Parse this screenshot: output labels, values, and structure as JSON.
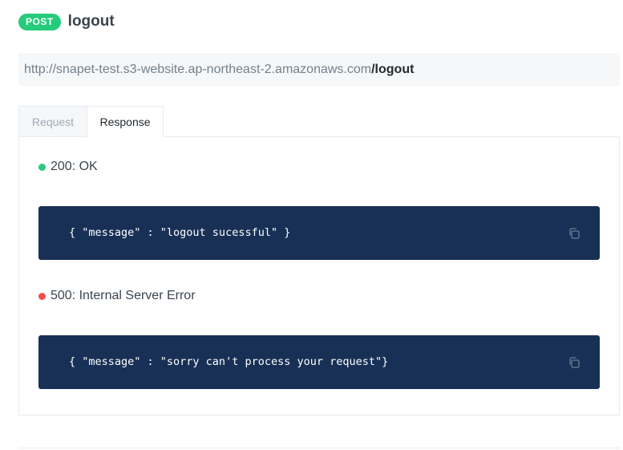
{
  "endpoint": {
    "method": "POST",
    "title": "logout",
    "url_base": "http://snapet-test.s3-website.ap-northeast-2.amazonaws.com",
    "url_path": "/logout"
  },
  "tabs": [
    {
      "label": "Request",
      "active": false
    },
    {
      "label": "Response",
      "active": true
    }
  ],
  "responses": [
    {
      "status": "200: OK",
      "color": "#26cb7c",
      "body": "{ \"message\" : \"logout sucessful\" }"
    },
    {
      "status": "500: Internal Server Error",
      "color": "#f05050",
      "body": "{ \"message\" : \"sorry can't process your request\"}"
    }
  ],
  "icons": {
    "copy": "copy-icon"
  },
  "colors": {
    "post_badge": "#26cb7c",
    "code_background": "#183055"
  }
}
